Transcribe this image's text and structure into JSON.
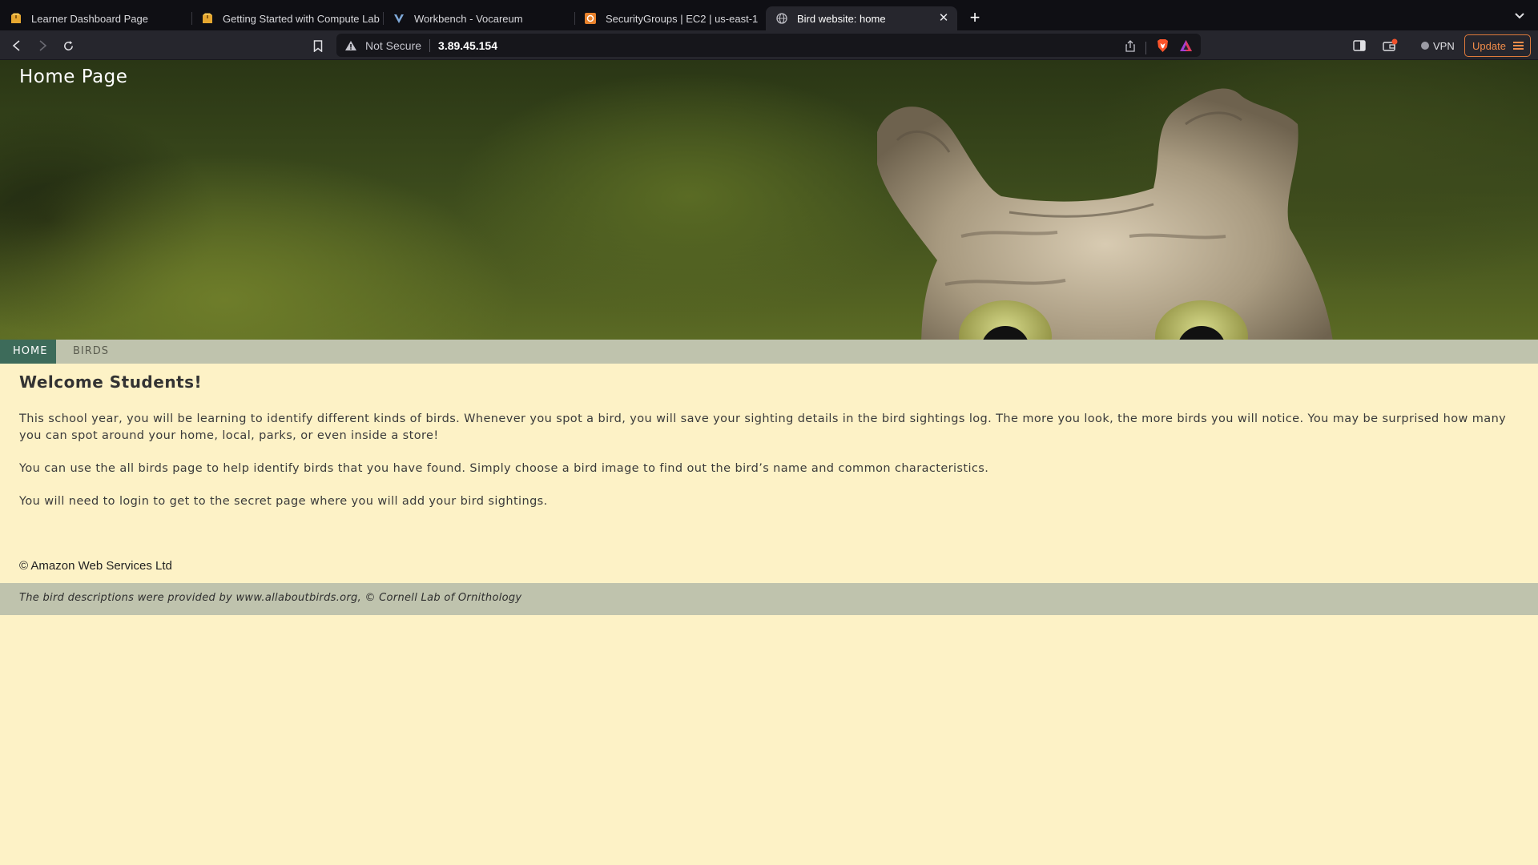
{
  "browser": {
    "tabs": [
      {
        "title": "Learner Dashboard Page",
        "icon": "aws-box-icon",
        "active": false
      },
      {
        "title": "Getting Started with Compute Lab",
        "icon": "aws-box-icon",
        "active": false
      },
      {
        "title": "Workbench - Vocareum",
        "icon": "vocareum-icon",
        "active": false
      },
      {
        "title": "SecurityGroups | EC2 | us-east-1",
        "icon": "aws-console-icon",
        "active": false
      },
      {
        "title": "Bird website: home",
        "icon": "globe-icon",
        "active": true
      }
    ],
    "address": {
      "security_label": "Not Secure",
      "url": "3.89.45.154"
    },
    "vpn_label": "VPN",
    "update_label": "Update"
  },
  "page": {
    "hero_title": "Home Page",
    "nav": {
      "home": "HOME",
      "birds": "BIRDS"
    },
    "heading": "Welcome Students!",
    "paragraphs": [
      "This school year, you will be learning to identify different kinds of birds. Whenever you spot a bird, you will save your sighting details in the bird sightings log. The more you look, the more birds you will notice. You may be surprised how many you can spot around your home, local, parks, or even inside a store!",
      "You can use the all birds page to help identify birds that you have found. Simply choose a bird image to find out the bird’s name and common characteristics.",
      "You will need to login to get to the secret page where you will add your bird sightings."
    ],
    "copyright": "© Amazon Web Services Ltd",
    "footer_text": "The bird descriptions were provided by www.allaboutbirds.org, © Cornell Lab of Ornithology"
  },
  "colors": {
    "page_bg": "#fdf2c6",
    "nav_bg": "#bfc3ad",
    "nav_active": "#3d6b5a",
    "update_accent": "#f08c4a"
  }
}
